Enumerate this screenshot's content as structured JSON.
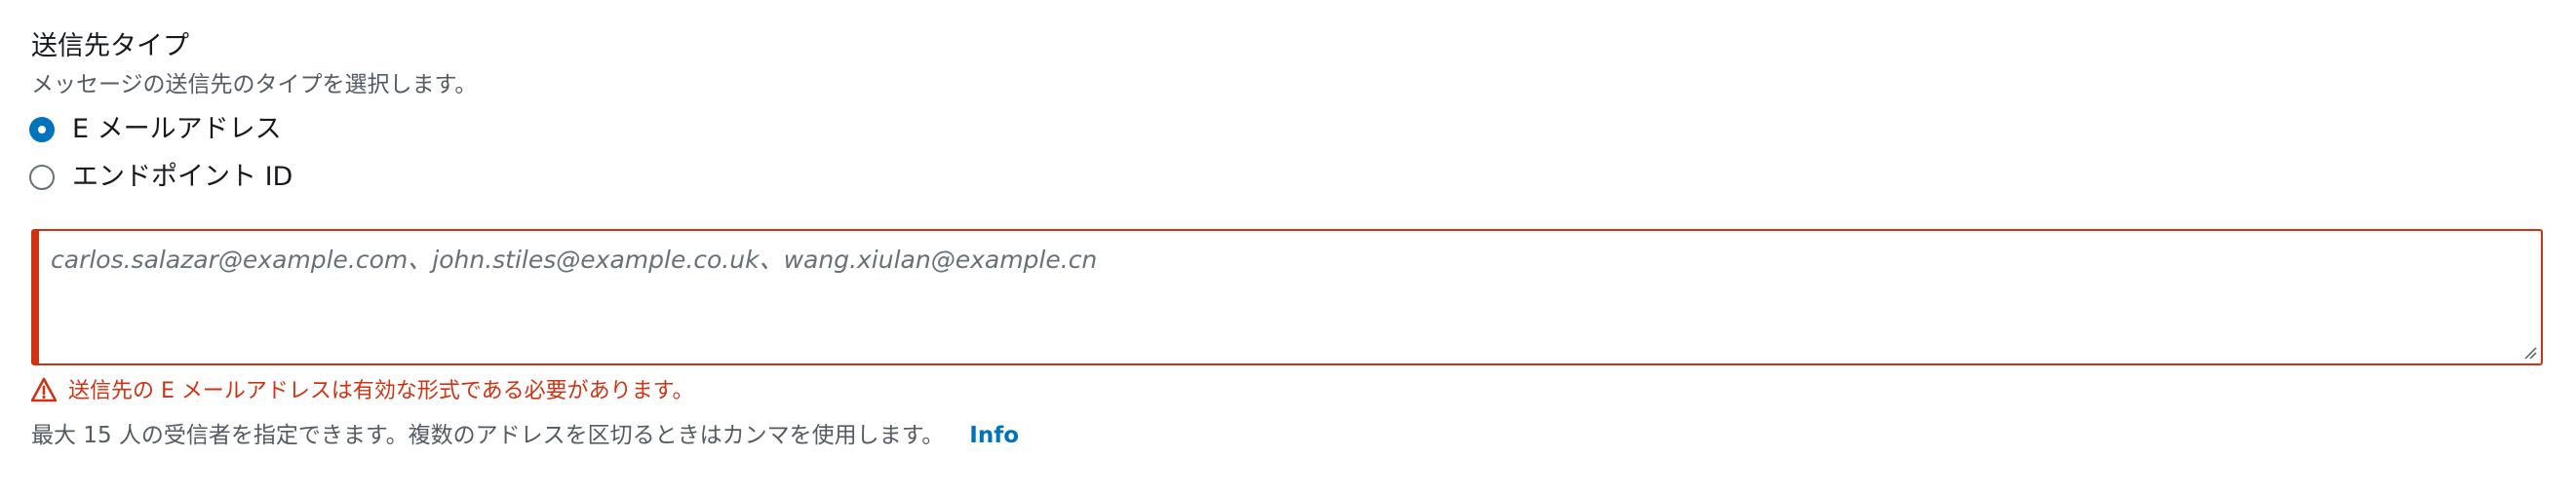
{
  "field": {
    "label": "送信先タイプ",
    "description": "メッセージの送信先のタイプを選択します。"
  },
  "radio_options": [
    {
      "label": "E メールアドレス",
      "checked": true
    },
    {
      "label": "エンドポイント ID",
      "checked": false
    }
  ],
  "recipients": {
    "value": "",
    "placeholder": "carlos.salazar@example.com、john.stiles@example.co.uk、wang.xiulan@example.cn"
  },
  "error": {
    "icon": "warning-icon",
    "message": "送信先の E メールアドレスは有効な形式である必要があります。"
  },
  "hint": {
    "text": "最大 15 人の受信者を指定できます。複数のアドレスを区切るときはカンマを使用します。",
    "info_link": "Info"
  },
  "colors": {
    "accent": "#0073bb",
    "error": "#d13212",
    "text": "#16191f",
    "secondary_text": "#545b64"
  }
}
